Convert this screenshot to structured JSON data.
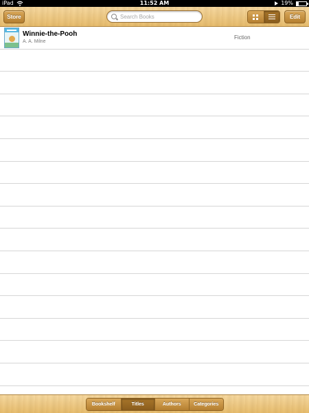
{
  "status_bar": {
    "device": "iPad",
    "time": "11:52 AM",
    "battery_text": "19%",
    "battery_level": 0.19,
    "icons": [
      "wifi-icon",
      "play-icon",
      "battery-icon"
    ]
  },
  "toolbar": {
    "store_label": "Store",
    "edit_label": "Edit",
    "search_placeholder": "Search Books",
    "view_modes": [
      "grid-view",
      "list-view"
    ],
    "active_view": "list-view"
  },
  "books": [
    {
      "title": "Winnie-the-Pooh",
      "author": "A. A. Milne",
      "category": "Fiction"
    }
  ],
  "bottom_tabs": {
    "items": [
      "Bookshelf",
      "Titles",
      "Authors",
      "Categories"
    ],
    "active": "Titles"
  },
  "colors": {
    "wood_light": "#f6d9a1",
    "wood_dark": "#e7bd6e",
    "button": "#b57f30",
    "button_active": "#8a5d1d"
  }
}
